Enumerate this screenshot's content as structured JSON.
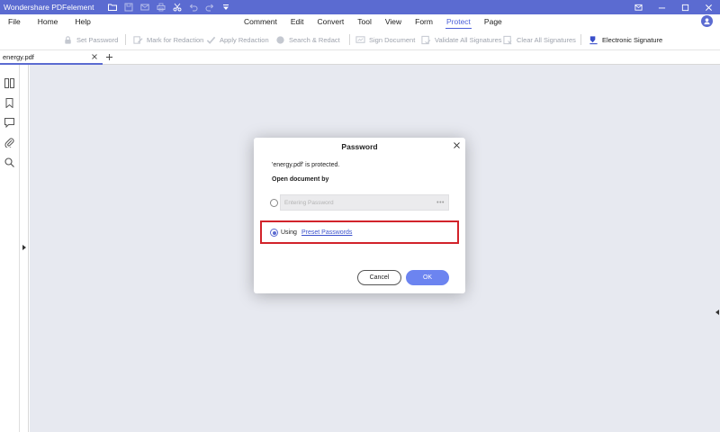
{
  "app": {
    "title": "Wondershare PDFelement"
  },
  "quick_access": [
    "folder-icon",
    "save-icon",
    "email-icon",
    "print-icon",
    "scissors-icon",
    "undo-icon",
    "redo-icon",
    "dropdown-icon"
  ],
  "menu": {
    "left": [
      "File",
      "Home",
      "Help"
    ],
    "center": [
      "Comment",
      "Edit",
      "Convert",
      "Tool",
      "View",
      "Form",
      "Protect",
      "Page"
    ],
    "active": "Protect"
  },
  "toolbar": {
    "set_password": "Set Password",
    "mark_for_redaction": "Mark for Redaction",
    "apply_redaction": "Apply Redaction",
    "search_redact": "Search & Redact",
    "sign_document": "Sign Document",
    "validate_all_signatures": "Validate All Signatures",
    "clear_all_signatures": "Clear All Signatures",
    "electronic_signature": "Electronic Signature"
  },
  "tab": {
    "label": "energy.pdf",
    "add": "+"
  },
  "dialog": {
    "title": "Password",
    "message": "'energy.pdf' is protected.",
    "subtitle": "Open document by",
    "option_entering": {
      "placeholder": "Entering Password",
      "selected": false
    },
    "option_using": {
      "label": "Using",
      "link": "Preset Passwords",
      "selected": true
    },
    "cancel": "Cancel",
    "ok": "OK"
  },
  "colors": {
    "titlebar": "#5b6bd1",
    "accent": "#4a5fd9",
    "highlight_border": "#d2232a",
    "ok_button": "#6c84f0",
    "canvas": "#e7e9f0"
  }
}
